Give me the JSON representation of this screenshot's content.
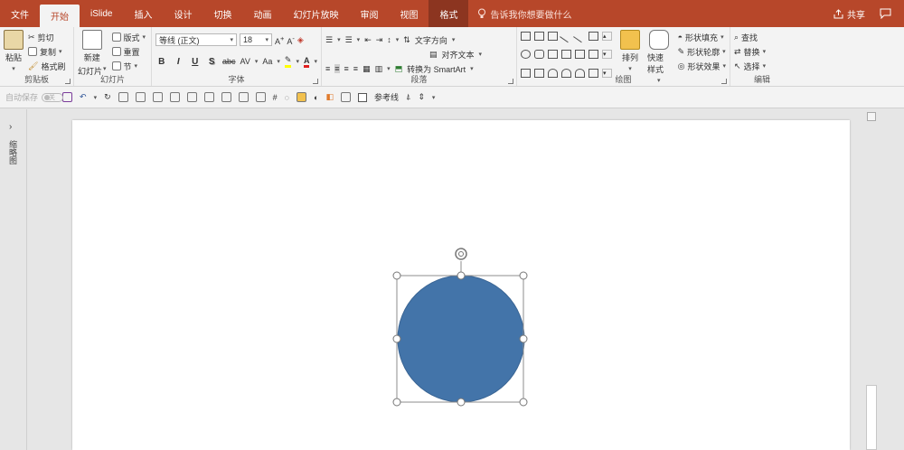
{
  "tabs": [
    {
      "label": "文件"
    },
    {
      "label": "开始",
      "active": true
    },
    {
      "label": "iSlide"
    },
    {
      "label": "插入"
    },
    {
      "label": "设计"
    },
    {
      "label": "切换"
    },
    {
      "label": "动画"
    },
    {
      "label": "幻灯片放映"
    },
    {
      "label": "审阅"
    },
    {
      "label": "视图"
    },
    {
      "label": "格式",
      "contextual": true
    }
  ],
  "tell_me": "告诉我你想要做什么",
  "share_label": "共享",
  "ribbon": {
    "clipboard": {
      "label": "剪贴板",
      "paste": "粘贴",
      "cut": "剪切",
      "copy": "复制",
      "format_painter": "格式刷"
    },
    "slides": {
      "label": "幻灯片",
      "new_slide": "新建",
      "new_slide_sub": "幻灯片",
      "layout": "版式",
      "reset": "重置",
      "section": "节"
    },
    "font": {
      "label": "字体",
      "font_name": "等线 (正文)",
      "font_size": "18",
      "bold": "B",
      "italic": "I",
      "underline": "U",
      "shadow": "S",
      "strike": "abc",
      "spacing": "AV",
      "case": "Aa"
    },
    "paragraph": {
      "label": "段落",
      "text_direction": "文字方向",
      "align_text": "对齐文本",
      "convert_smartart": "转换为 SmartArt"
    },
    "drawing": {
      "label": "绘图",
      "arrange": "排列",
      "quick_styles": "快速样式",
      "shape_fill": "形状填充",
      "shape_outline": "形状轮廓",
      "shape_effects": "形状效果"
    },
    "editing": {
      "label": "编辑",
      "find": "查找",
      "replace": "替换",
      "select": "选择"
    }
  },
  "qat": {
    "autosave_label": "自动保存",
    "autosave_state": "关",
    "guides_label": "参考线"
  },
  "left_pane": {
    "label": "缩略图"
  },
  "slide": {
    "shape": {
      "type": "ellipse",
      "fill": "#4374a9",
      "stroke": "#3a6594",
      "selected": true
    }
  },
  "colors": {
    "accent": "#b7472a",
    "ribbon_bg": "#f3f3f3",
    "canvas_bg": "#e6e6e6",
    "selection": "#8c8c8c"
  }
}
